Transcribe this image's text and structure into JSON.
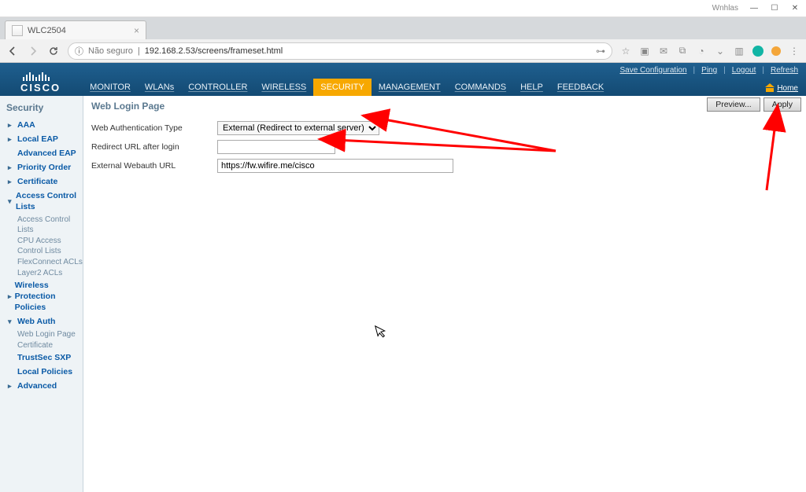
{
  "window": {
    "user": "Wnhlas"
  },
  "browser": {
    "tab_title": "WLC2504",
    "url_prefix_label": "Não seguro",
    "url": "192.168.2.53/screens/frameset.html"
  },
  "header": {
    "brand": "CISCO",
    "nav": [
      "MONITOR",
      "WLANs",
      "CONTROLLER",
      "WIRELESS",
      "SECURITY",
      "MANAGEMENT",
      "COMMANDS",
      "HELP",
      "FEEDBACK"
    ],
    "active_nav_index": 4,
    "right_links": [
      "Save Configuration",
      "Ping",
      "Logout",
      "Refresh"
    ],
    "home_label": "Home"
  },
  "sidebar": {
    "title": "Security",
    "items": [
      {
        "label": "AAA",
        "type": "collapsed"
      },
      {
        "label": "Local EAP",
        "type": "collapsed"
      },
      {
        "label": "Advanced EAP",
        "type": "leaf"
      },
      {
        "label": "Priority Order",
        "type": "collapsed"
      },
      {
        "label": "Certificate",
        "type": "collapsed"
      },
      {
        "label": "Access Control Lists",
        "type": "expanded",
        "children": [
          "Access Control Lists",
          "CPU Access Control Lists",
          "FlexConnect ACLs",
          "Layer2 ACLs"
        ]
      },
      {
        "label": "Wireless Protection Policies",
        "type": "collapsed"
      },
      {
        "label": "Web Auth",
        "type": "expanded",
        "children": [
          "Web Login Page",
          "Certificate"
        ]
      },
      {
        "label": "TrustSec SXP",
        "type": "leaf-bold"
      },
      {
        "label": "Local Policies",
        "type": "leaf-bold"
      },
      {
        "label": "Advanced",
        "type": "collapsed"
      }
    ]
  },
  "content": {
    "title": "Web Login Page",
    "buttons": {
      "preview": "Preview...",
      "apply": "Apply"
    },
    "fields": {
      "auth_type_label": "Web Authentication Type",
      "auth_type_value": "External (Redirect to external server)",
      "redirect_label": "Redirect URL after login",
      "redirect_value": "",
      "ext_url_label": "External Webauth URL",
      "ext_url_value": "https://fw.wifire.me/cisco"
    }
  }
}
